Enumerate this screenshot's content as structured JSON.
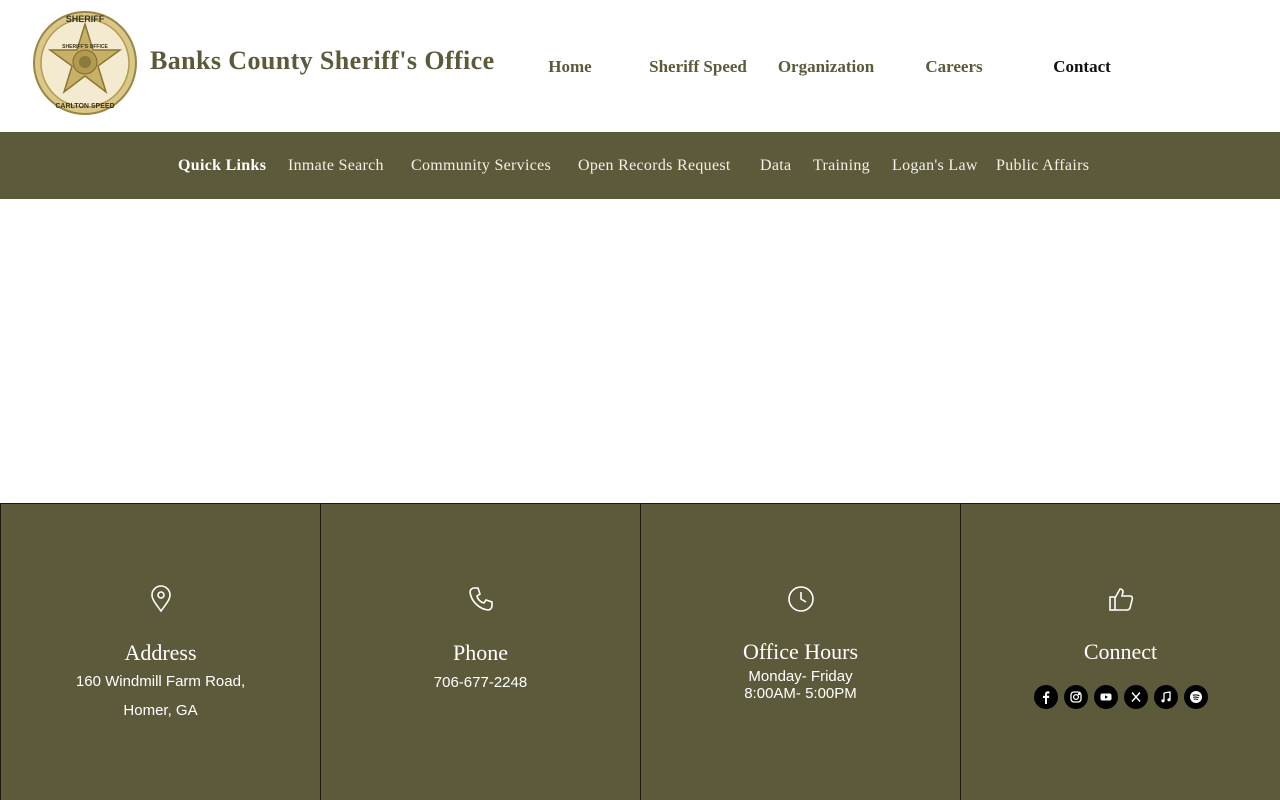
{
  "header": {
    "logo_alt": "Banks County Sheriff's Office badge",
    "title": "Banks County Sheriff's Office",
    "badge_top": "SHERIFF",
    "badge_mid": "SHERIFF'S OFFICE",
    "badge_bottom": "CARLTON SPEED",
    "nav": [
      {
        "label": "Home"
      },
      {
        "label": "Sheriff Speed"
      },
      {
        "label": "Organization"
      },
      {
        "label": "Careers"
      },
      {
        "label": "Contact"
      }
    ]
  },
  "subnav": {
    "items": [
      {
        "label": "Quick Links"
      },
      {
        "label": "Inmate Search"
      },
      {
        "label": "Community Services"
      },
      {
        "label": "Open Records Request"
      },
      {
        "label": "Data"
      },
      {
        "label": "Training"
      },
      {
        "label": "Logan's Law"
      },
      {
        "label": "Public Affairs"
      }
    ]
  },
  "footer": {
    "address": {
      "heading": "Address",
      "line1": "160 Windmill Farm Road,",
      "line2": "Homer, GA"
    },
    "phone": {
      "heading": "Phone",
      "number": "706-677-2248"
    },
    "hours": {
      "heading": "Office Hours",
      "line1": "Monday- Friday",
      "line2": "8:00AM- 5:00PM"
    },
    "connect": {
      "heading": "Connect",
      "icons": [
        "facebook-icon",
        "instagram-icon",
        "youtube-icon",
        "x-icon",
        "apple-music-icon",
        "spotify-icon"
      ]
    }
  },
  "colors": {
    "accent": "#5c5a3a",
    "text_light": "#ffffff"
  }
}
